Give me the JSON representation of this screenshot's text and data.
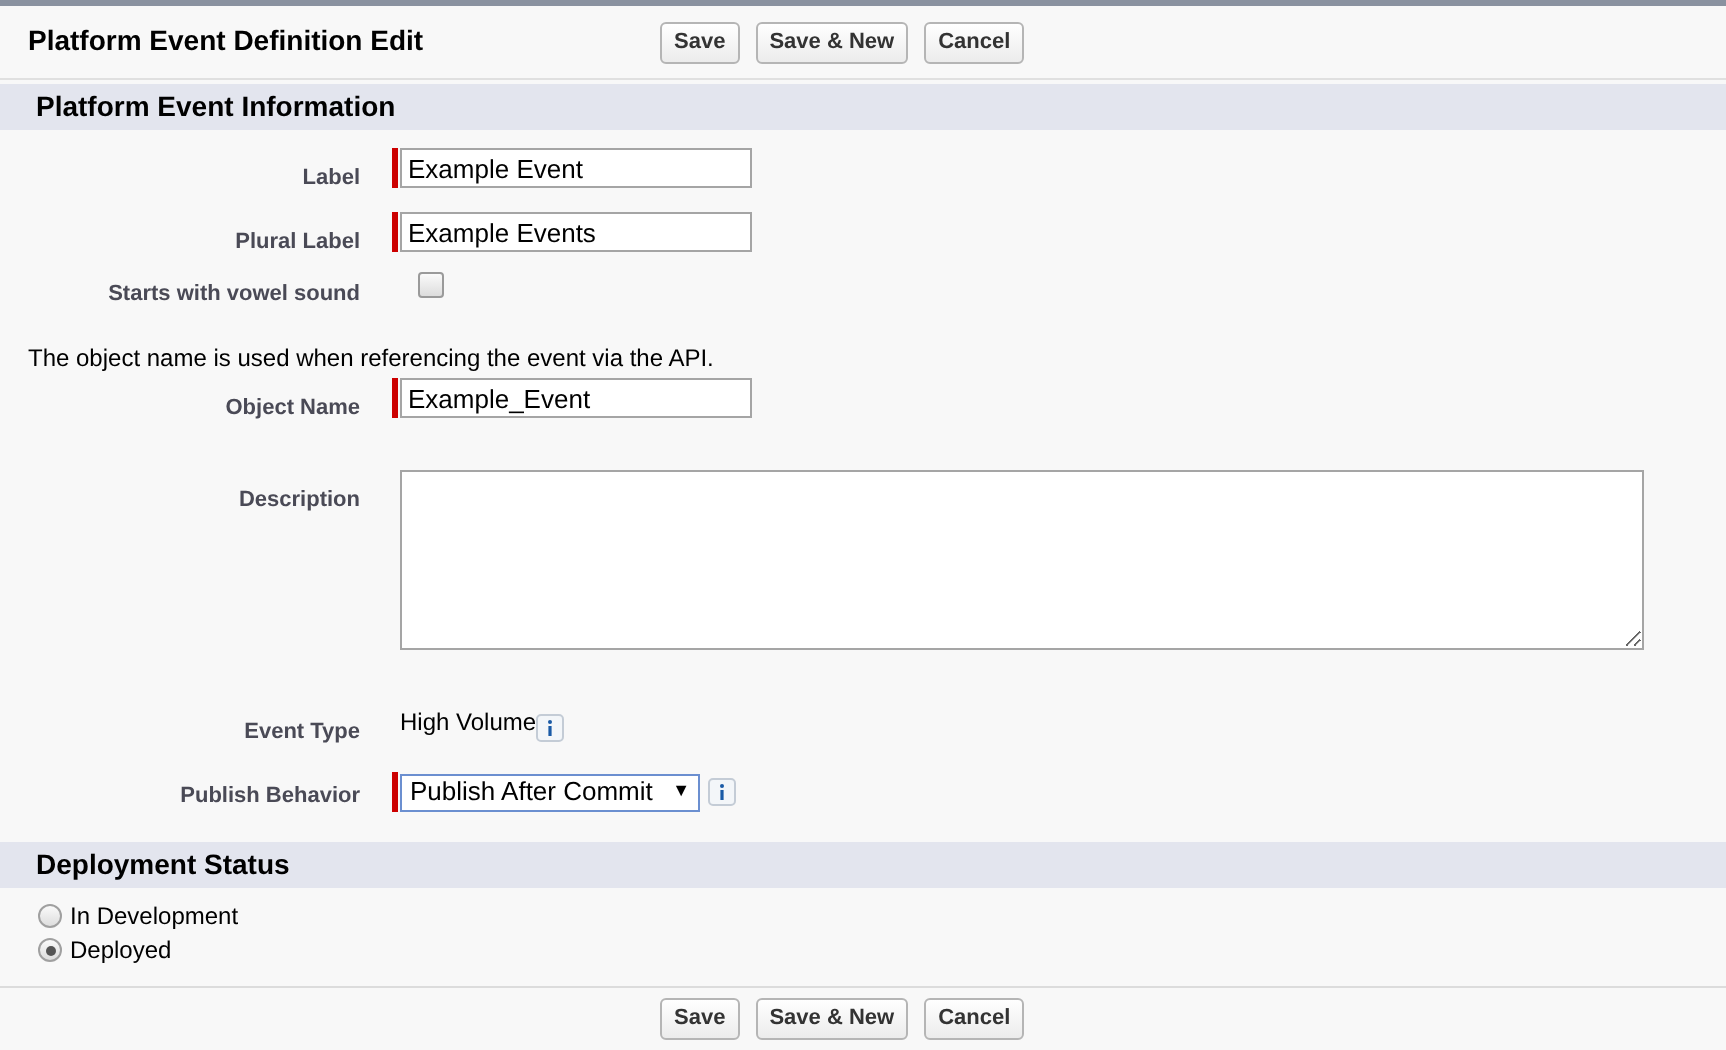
{
  "header": {
    "title": "Platform Event Definition Edit",
    "buttons": [
      "Save",
      "Save & New",
      "Cancel"
    ]
  },
  "sections": [
    {
      "title": "Platform Event Information",
      "fields": [
        {
          "kind": "text",
          "label": "Label",
          "value": "Example Event",
          "required": true
        },
        {
          "kind": "text",
          "label": "Plural Label",
          "value": "Example Events",
          "required": true
        },
        {
          "kind": "checkbox",
          "label": "Starts with vowel sound",
          "checked": false
        },
        {
          "kind": "note",
          "text": "The object name is used when referencing the event via the API."
        },
        {
          "kind": "text",
          "label": "Object Name",
          "value": "Example_Event",
          "required": true
        },
        {
          "kind": "textarea",
          "label": "Description"
        },
        {
          "kind": "static",
          "label": "Event Type",
          "value": "High Volume",
          "info": true
        },
        {
          "kind": "select",
          "label": "Publish Behavior",
          "value": "Publish After Commit",
          "caret": "▼",
          "required": true,
          "info": true
        }
      ]
    },
    {
      "title": "Deployment Status",
      "fields": [
        {
          "kind": "radio",
          "label": "In Development",
          "selected": false
        },
        {
          "kind": "radio",
          "label": "Deployed",
          "selected": true
        }
      ]
    }
  ],
  "footer": {
    "buttons": [
      "Save",
      "Save & New",
      "Cancel"
    ]
  }
}
